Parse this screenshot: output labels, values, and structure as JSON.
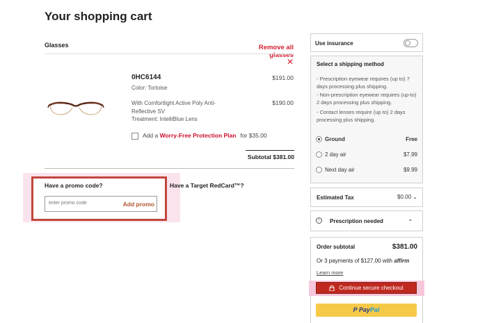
{
  "page": {
    "title": "Your shopping cart"
  },
  "cart": {
    "section_label": "Glasses",
    "remove_all_label": "Remove all glasses",
    "item": {
      "name": "0HC6144",
      "price": "$191.00",
      "color": "Color: Tortoise",
      "lens_description": "With Comfortlight Active Poly Anti-Reflective SV",
      "lens_price": "$190.00",
      "treatment": "Treatment: IntelliBlue Lens"
    },
    "protection": {
      "prefix": "Add a ",
      "plan_label": "Worry-Free Protection Plan",
      "price_text": "for $35.00",
      "checked": false
    },
    "subtotal": "Subtotal $381.00"
  },
  "promo": {
    "title": "Have a promo code?",
    "placeholder": "enter promo code",
    "button_label": "Add promo"
  },
  "redcard": {
    "label": "Have a Target RedCard™?"
  },
  "sidebar": {
    "insurance_label": "Use insurance",
    "insurance_enabled": false,
    "shipping": {
      "title": "Select a shipping method",
      "notes": [
        "- Prescription eyewear requires (up to) 7 days processing plus shipping.",
        "- Non-prescription eyewear requires (up-to) 2 days processing plus shipping.",
        "- Contact lenses require (up to) 2 days processing plus shipping."
      ],
      "options": [
        {
          "label": "Ground",
          "price": "Free",
          "selected": true
        },
        {
          "label": "2 day air",
          "price": "$7.99",
          "selected": false
        },
        {
          "label": "Next day air",
          "price": "$9.99",
          "selected": false
        }
      ]
    },
    "tax": {
      "label": "Estimated Tax",
      "value": "$0.00"
    },
    "prescription_label": "Prescription needed",
    "order": {
      "label": "Order subtotal",
      "value": "$381.00",
      "affirm_text": "Or 3 payments of $127.00 with",
      "affirm_brand": "affirm",
      "learn_more": "Learn more",
      "checkout_label": "Continue secure checkout",
      "paypal_pay": "Pay",
      "paypal_pal": "Pal"
    }
  },
  "colors": {
    "accent_red": "#c8102e",
    "checkout_red": "#c0291f",
    "paypal_yellow": "#f7c948",
    "promo_border": "#c0463a"
  }
}
